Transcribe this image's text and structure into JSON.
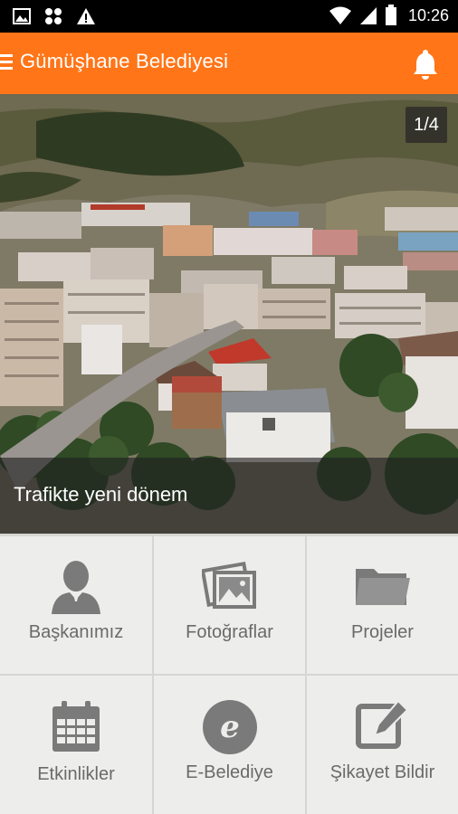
{
  "status_bar": {
    "time": "10:26",
    "left_icons": [
      "image-icon",
      "pinwheel-icon",
      "warning-icon"
    ],
    "right_icons": [
      "wifi-icon",
      "signal-icon",
      "battery-icon"
    ]
  },
  "app_bar": {
    "title": "Gümüşhane Belediyesi",
    "menu_icon": "menu-icon",
    "action_icon": "bell-icon",
    "color": "#ff7518"
  },
  "slider": {
    "counter": "1/4",
    "caption": "Trafikte yeni dönem"
  },
  "menu": {
    "items": [
      {
        "label": "Başkanımız",
        "icon": "person-icon"
      },
      {
        "label": "Fotoğraflar",
        "icon": "photos-icon"
      },
      {
        "label": "Projeler",
        "icon": "folder-icon"
      },
      {
        "label": "Etkinlikler",
        "icon": "calendar-icon"
      },
      {
        "label": "E-Belediye",
        "icon": "e-icon"
      },
      {
        "label": "Şikayet Bildir",
        "icon": "edit-icon"
      }
    ]
  }
}
